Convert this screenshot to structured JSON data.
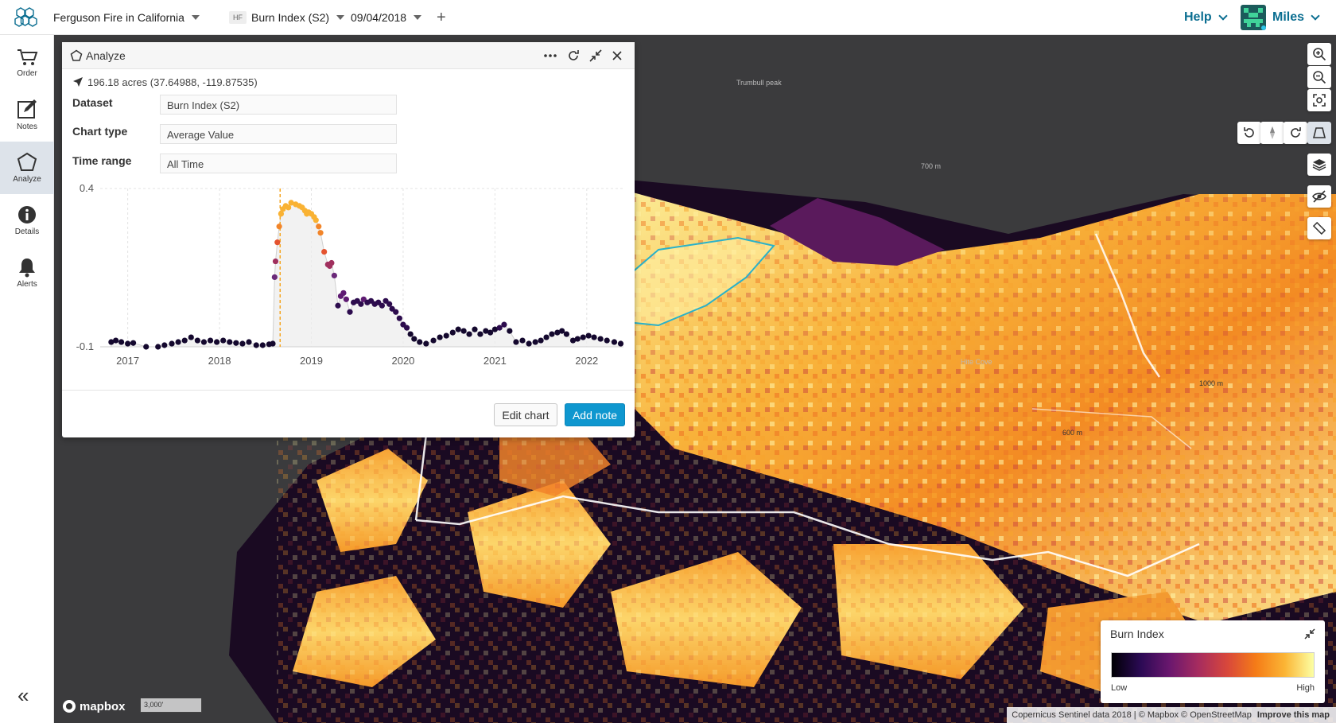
{
  "topbar": {
    "project": "Ferguson Fire in California",
    "dataset_badge": "HF",
    "dataset": "Burn Index (S2)",
    "date": "09/04/2018",
    "add_label": "+",
    "help_label": "Help",
    "user_name": "Miles"
  },
  "sidebar": {
    "items": [
      {
        "label": "Order",
        "icon": "cart-icon"
      },
      {
        "label": "Notes",
        "icon": "notes-icon"
      },
      {
        "label": "Analyze",
        "icon": "analyze-icon"
      },
      {
        "label": "Details",
        "icon": "info-icon"
      },
      {
        "label": "Alerts",
        "icon": "bell-icon"
      }
    ],
    "active": "Analyze",
    "collapse_label": "«"
  },
  "analyze": {
    "title": "Analyze",
    "area": "196.18 acres (37.64988, -119.87535)",
    "dataset_label": "Dataset",
    "dataset_value": "Burn Index (S2)",
    "chart_type_label": "Chart type",
    "chart_type_value": "Average Value",
    "time_range_label": "Time range",
    "time_range_value": "All Time",
    "edit_chart": "Edit chart",
    "add_note": "Add note"
  },
  "chart_data": {
    "type": "scatter",
    "title": "",
    "xlabel": "",
    "ylabel": "",
    "x_ticks": [
      "2017",
      "2018",
      "2019",
      "2020",
      "2021",
      "2022"
    ],
    "y_ticks": [
      "0.4",
      "-0.1"
    ],
    "ylim": [
      -0.1,
      0.4
    ],
    "xlim": [
      2016.7,
      2022.4
    ],
    "marker_line_x": 2018.66,
    "grid": true,
    "series": [
      {
        "points": [
          [
            2016.82,
            -0.085
          ],
          [
            2016.87,
            -0.08
          ],
          [
            2016.93,
            -0.085
          ],
          [
            2017.0,
            -0.09
          ],
          [
            2017.06,
            -0.088
          ],
          [
            2017.2,
            -0.1
          ],
          [
            2017.33,
            -0.1
          ],
          [
            2017.4,
            -0.095
          ],
          [
            2017.48,
            -0.09
          ],
          [
            2017.55,
            -0.085
          ],
          [
            2017.62,
            -0.08
          ],
          [
            2017.69,
            -0.07
          ],
          [
            2017.76,
            -0.08
          ],
          [
            2017.83,
            -0.085
          ],
          [
            2017.9,
            -0.08
          ],
          [
            2017.97,
            -0.085
          ],
          [
            2018.04,
            -0.08
          ],
          [
            2018.11,
            -0.085
          ],
          [
            2018.18,
            -0.088
          ],
          [
            2018.25,
            -0.09
          ],
          [
            2018.32,
            -0.085
          ],
          [
            2018.4,
            -0.095
          ],
          [
            2018.47,
            -0.095
          ],
          [
            2018.54,
            -0.092
          ],
          [
            2018.58,
            -0.09
          ],
          [
            2018.6,
            0.12
          ],
          [
            2018.61,
            0.17
          ],
          [
            2018.63,
            0.23
          ],
          [
            2018.65,
            0.28
          ],
          [
            2018.67,
            0.32
          ],
          [
            2018.69,
            0.335
          ],
          [
            2018.72,
            0.345
          ],
          [
            2018.75,
            0.34
          ],
          [
            2018.78,
            0.355
          ],
          [
            2018.83,
            0.35
          ],
          [
            2018.87,
            0.345
          ],
          [
            2018.9,
            0.34
          ],
          [
            2018.93,
            0.33
          ],
          [
            2018.95,
            0.32
          ],
          [
            2018.97,
            0.325
          ],
          [
            2019.0,
            0.32
          ],
          [
            2019.03,
            0.31
          ],
          [
            2019.05,
            0.3
          ],
          [
            2019.08,
            0.28
          ],
          [
            2019.1,
            0.26
          ],
          [
            2019.14,
            0.2
          ],
          [
            2019.18,
            0.16
          ],
          [
            2019.2,
            0.155
          ],
          [
            2019.22,
            0.165
          ],
          [
            2019.25,
            0.125
          ],
          [
            2019.29,
            0.03
          ],
          [
            2019.32,
            0.06
          ],
          [
            2019.35,
            0.07
          ],
          [
            2019.38,
            0.05
          ],
          [
            2019.42,
            0.01
          ],
          [
            2019.46,
            0.04
          ],
          [
            2019.5,
            0.045
          ],
          [
            2019.54,
            0.035
          ],
          [
            2019.57,
            0.05
          ],
          [
            2019.61,
            0.04
          ],
          [
            2019.65,
            0.045
          ],
          [
            2019.69,
            0.035
          ],
          [
            2019.73,
            0.04
          ],
          [
            2019.77,
            0.03
          ],
          [
            2019.81,
            0.045
          ],
          [
            2019.85,
            0.035
          ],
          [
            2019.88,
            0.02
          ],
          [
            2019.92,
            0.01
          ],
          [
            2019.96,
            -0.01
          ],
          [
            2020.0,
            -0.03
          ],
          [
            2020.04,
            -0.04
          ],
          [
            2020.08,
            -0.06
          ],
          [
            2020.12,
            -0.075
          ],
          [
            2020.18,
            -0.085
          ],
          [
            2020.25,
            -0.09
          ],
          [
            2020.33,
            -0.08
          ],
          [
            2020.4,
            -0.07
          ],
          [
            2020.47,
            -0.065
          ],
          [
            2020.54,
            -0.055
          ],
          [
            2020.6,
            -0.045
          ],
          [
            2020.66,
            -0.05
          ],
          [
            2020.72,
            -0.06
          ],
          [
            2020.78,
            -0.045
          ],
          [
            2020.84,
            -0.06
          ],
          [
            2020.9,
            -0.05
          ],
          [
            2020.95,
            -0.055
          ],
          [
            2021.0,
            -0.045
          ],
          [
            2021.05,
            -0.04
          ],
          [
            2021.1,
            -0.03
          ],
          [
            2021.16,
            -0.05
          ],
          [
            2021.23,
            -0.085
          ],
          [
            2021.3,
            -0.08
          ],
          [
            2021.37,
            -0.09
          ],
          [
            2021.44,
            -0.085
          ],
          [
            2021.5,
            -0.08
          ],
          [
            2021.56,
            -0.07
          ],
          [
            2021.62,
            -0.06
          ],
          [
            2021.68,
            -0.055
          ],
          [
            2021.73,
            -0.05
          ],
          [
            2021.78,
            -0.06
          ],
          [
            2021.85,
            -0.08
          ],
          [
            2021.9,
            -0.075
          ],
          [
            2021.96,
            -0.07
          ],
          [
            2022.02,
            -0.065
          ],
          [
            2022.08,
            -0.07
          ],
          [
            2022.15,
            -0.075
          ],
          [
            2022.22,
            -0.08
          ],
          [
            2022.3,
            -0.085
          ],
          [
            2022.37,
            -0.09
          ]
        ]
      }
    ]
  },
  "map": {
    "labels": [
      "Trumbull peak",
      "700 m",
      "Hite Cove",
      "600 m",
      "1000 m"
    ],
    "scale": "3,000'",
    "attribution": "Copernicus Sentinel data 2018 | © Mapbox © OpenStreetMap",
    "improve": "Improve this map",
    "mapbox": "mapbox"
  },
  "legend": {
    "title": "Burn Index",
    "low": "Low",
    "high": "High"
  },
  "colors": {
    "accent": "#0f97cf",
    "brand": "#0b6e91",
    "marker_line": "#f5a623"
  }
}
